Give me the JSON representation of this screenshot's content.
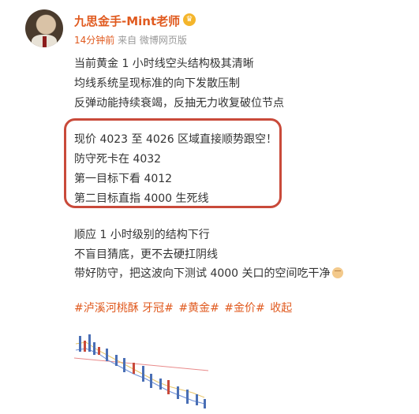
{
  "header": {
    "author": "九思金手-Mint老师",
    "time": "14分钟前",
    "source": "来自 微博网页版"
  },
  "post": {
    "lines": [
      "当前黄金 1 小时线空头结构极其清晰",
      "均线系统呈现标准的向下发散压制",
      "反弹动能持续衰竭，反抽无力收复破位节点"
    ],
    "boxed": [
      "现价 4023 至 4026 区域直接顺势跟空！",
      "防守死卡在 4032",
      "第一目标下看 4012",
      "第二目标直指 4000 生死线"
    ],
    "after": [
      "顺应 1 小时级别的结构下行",
      "不盲目猜底，更不去硬扛阴线",
      "带好防守，把这波向下测试 4000 关口的空间吃干净"
    ],
    "tags": {
      "tag1": "#泸溪河桃酥 牙冠#",
      "tag2": "#黄金#",
      "tag3": "#金价#",
      "collapse": "收起"
    }
  },
  "icons": {
    "vip": "crown-icon",
    "emoji": "fist-emoji-icon"
  },
  "colors": {
    "accent": "#e05a1f",
    "box_border": "#c94a3a",
    "meta": "#999999"
  }
}
